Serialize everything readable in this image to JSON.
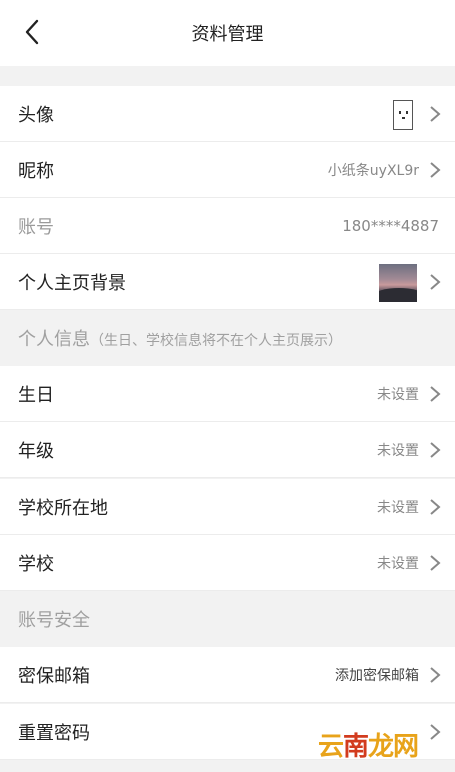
{
  "header": {
    "title": "资料管理"
  },
  "rows": {
    "avatar": {
      "label": "头像"
    },
    "nickname": {
      "label": "昵称",
      "value": "小纸条uyXL9r"
    },
    "account": {
      "label": "账号",
      "value": "180****4887"
    },
    "homepage_bg": {
      "label": "个人主页背景"
    }
  },
  "section_personal": {
    "title": "个人信息",
    "note": "（生日、学校信息将不在个人主页展示）"
  },
  "personal": {
    "birthday": {
      "label": "生日",
      "value": "未设置"
    },
    "grade": {
      "label": "年级",
      "value": "未设置"
    },
    "school_location": {
      "label": "学校所在地",
      "value": "未设置"
    },
    "school": {
      "label": "学校",
      "value": "未设置"
    }
  },
  "section_security": {
    "title": "账号安全"
  },
  "security": {
    "email": {
      "label": "密保邮箱",
      "value": "添加密保邮箱"
    },
    "reset_password": {
      "label": "重置密码"
    }
  },
  "watermark": {
    "part1": "云",
    "part2": "南",
    "part3": "龙网"
  }
}
